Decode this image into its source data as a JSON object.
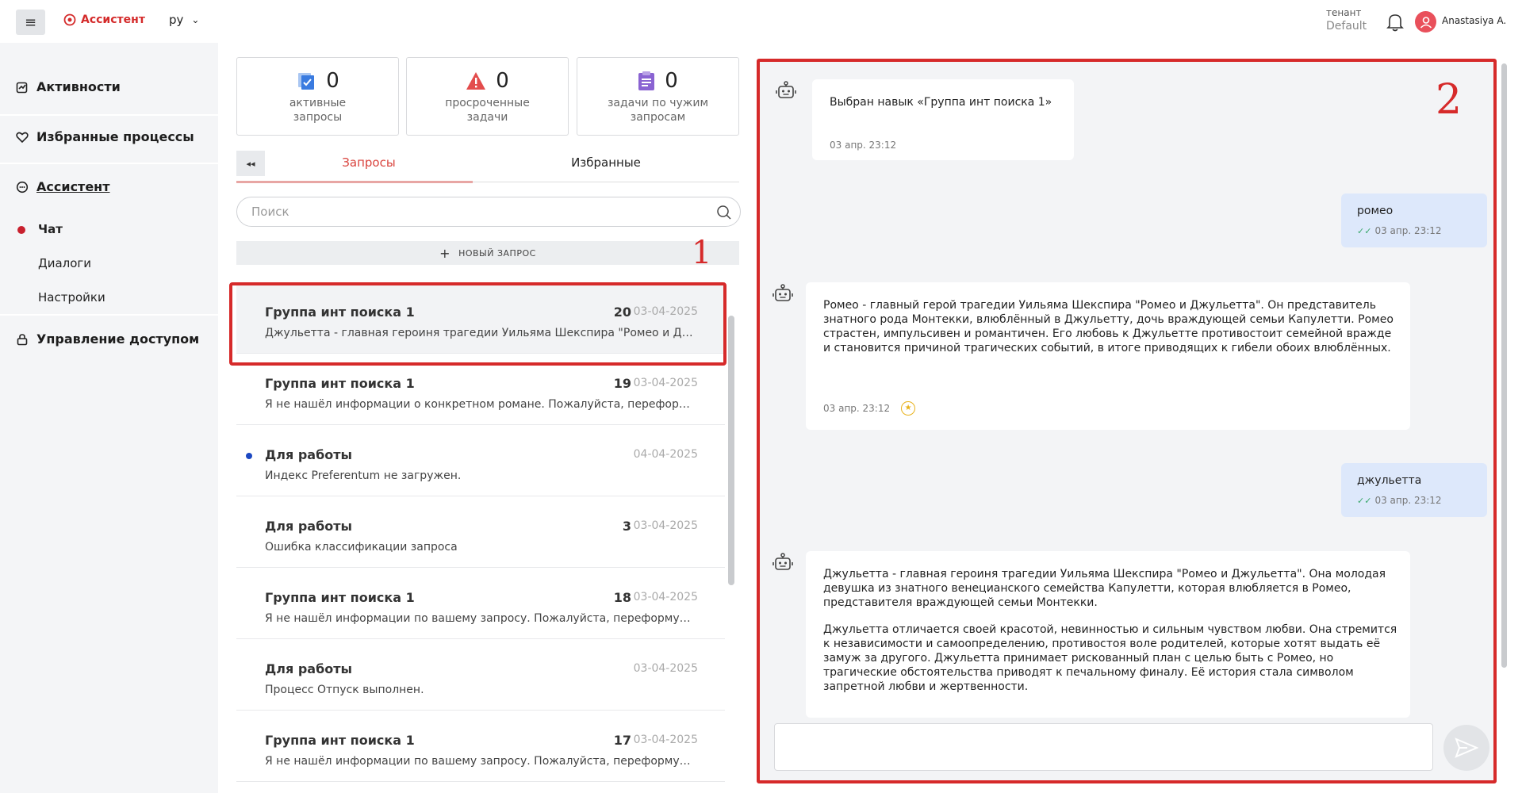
{
  "header": {
    "brand": "Ассистент",
    "lang": "ру",
    "tenant_label": "тенант",
    "tenant_value": "Default",
    "user_name": "Anastasiya A."
  },
  "sidebar": {
    "items": [
      {
        "label": "Активности",
        "icon": "activity-icon"
      },
      {
        "label": "Избранные процессы",
        "icon": "heart-icon"
      },
      {
        "label": "Ассистент",
        "icon": "chat-bubble-icon"
      },
      {
        "label": "Управление доступом",
        "icon": "lock-icon"
      }
    ],
    "sub_items": [
      {
        "label": "Чат",
        "active": true
      },
      {
        "label": "Диалоги",
        "active": false
      },
      {
        "label": "Настройки",
        "active": false
      }
    ]
  },
  "stats": [
    {
      "value": "0",
      "label_line1": "активные",
      "label_line2": "запросы",
      "icon": "checklist-icon",
      "color": "#3a7be0"
    },
    {
      "value": "0",
      "label_line1": "просроченные",
      "label_line2": "задачи",
      "icon": "warning-icon",
      "color": "#e34c4c"
    },
    {
      "value": "0",
      "label_line1": "задачи по чужим",
      "label_line2": "запросам",
      "icon": "clipboard-icon",
      "color": "#8a63d2"
    }
  ],
  "tabs": {
    "collapse": "◂◂",
    "active": "Запросы",
    "other": "Избранные"
  },
  "search": {
    "placeholder": "Поиск"
  },
  "new_request": {
    "label": "НОВЫЙ ЗАПРОС"
  },
  "markers": {
    "one": "1",
    "two": "2"
  },
  "requests": [
    {
      "title": "Группа инт поиска 1",
      "count": "20",
      "date": "03-04-2025",
      "preview": "Джульетта - главная героиня трагедии Уильяма Шекспира \"Ромео и Джульетта\". Она молодая девушка",
      "unread": false,
      "selected": true
    },
    {
      "title": "Группа инт поиска 1",
      "count": "19",
      "date": "03-04-2025",
      "preview": "Я не нашёл информации о конкретном романе. Пожалуйста, переформулируйте запрос",
      "unread": false,
      "selected": false
    },
    {
      "title": "Для работы",
      "count": "",
      "date": "04-04-2025",
      "preview": "Индекс Preferentum не загружен.",
      "unread": true,
      "selected": false
    },
    {
      "title": "Для работы",
      "count": "3",
      "date": "03-04-2025",
      "preview": "Ошибка классификации запроса",
      "unread": false,
      "selected": false
    },
    {
      "title": "Группа инт поиска 1",
      "count": "18",
      "date": "03-04-2025",
      "preview": "Я не нашёл информации по вашему запросу. Пожалуйста, переформулируйте запрос",
      "unread": false,
      "selected": false
    },
    {
      "title": "Для работы",
      "count": "",
      "date": "03-04-2025",
      "preview": "Процесс Отпуск выполнен.",
      "unread": false,
      "selected": false
    },
    {
      "title": "Группа инт поиска 1",
      "count": "17",
      "date": "03-04-2025",
      "preview": "Я не нашёл информации по вашему запросу. Пожалуйста, переформулируйте запрос",
      "unread": false,
      "selected": false
    }
  ],
  "chat": {
    "messages": [
      {
        "from": "bot",
        "text": "Выбран навык «Группа инт поиска 1»",
        "time": "03 апр. 23:12"
      },
      {
        "from": "user",
        "text": "ромео",
        "time": "03 апр. 23:12"
      },
      {
        "from": "bot",
        "text": "Ромео - главный герой трагедии Уильяма Шекспира \"Ромео и Джульетта\". Он представитель знатного рода Монтекки, влюблённый в Джульетту, дочь враждующей семьи Капулетти. Ромео страстен, импульсивен и романтичен. Его любовь к Джульетте противостоит семейной вражде и становится причиной трагических событий, в итоге приводящих к гибели обоих влюблённых.",
        "time": "03 апр. 23:12"
      },
      {
        "from": "user",
        "text": "джульетта",
        "time": "03 апр. 23:12"
      },
      {
        "from": "bot",
        "text": "Джульетта - главная героиня трагедии Уильяма Шекспира \"Ромео и Джульетта\". Она молодая девушка из знатного венецианского семейства Капулетти, которая влюбляется в Ромео, представителя враждующей семьи Монтекки.",
        "text2": "Джульетта отличается своей красотой, невинностью и сильным чувством любви. Она стремится к независимости и самоопределению, противостоя воле родителей, которые хотят выдать её замуж за другого. Джульетта принимает рискованный план с целью быть с Ромео, но трагические обстоятельства приводят к печальному финалу. Её история стала символом запретной любви и жертвенности."
      }
    ]
  }
}
